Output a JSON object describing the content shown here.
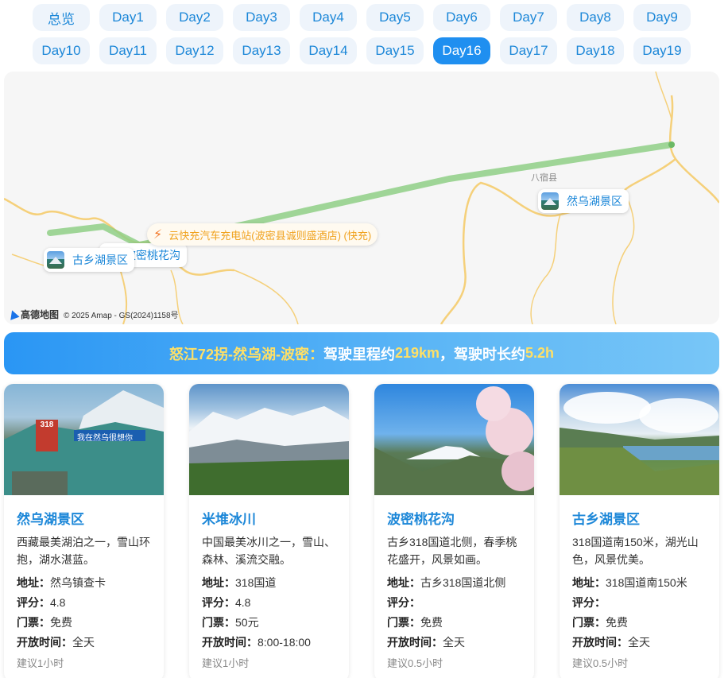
{
  "tabs": [
    "总览",
    "Day1",
    "Day2",
    "Day3",
    "Day4",
    "Day5",
    "Day6",
    "Day7",
    "Day8",
    "Day9",
    "Day10",
    "Day11",
    "Day12",
    "Day13",
    "Day14",
    "Day15",
    "Day16",
    "Day17",
    "Day18",
    "Day19"
  ],
  "active_tab": "Day16",
  "map": {
    "markers": {
      "ranwu": "然乌湖景区",
      "guxiang": "古乡湖景区",
      "taohua": "波密桃花沟"
    },
    "charger": "云快充汽车充电站(波密县诚则盛酒店) (快充)",
    "place_label": "八宿县",
    "copyright": "© 2025 Amap - GS(2024)1158号",
    "logo_text": "高德地图",
    "route_color": "#8fcf86",
    "road_color": "#f5d07a"
  },
  "banner": {
    "prefix": "怒江72拐-然乌湖-波密：",
    "distance_label": "驾驶里程约",
    "distance_value": "219km",
    "sep": "，",
    "duration_label": "驾驶时长约",
    "duration_value": "5.2h"
  },
  "labels": {
    "address": "地址：",
    "rating": "评分：",
    "ticket": "门票：",
    "hours": "开放时间："
  },
  "cards": [
    {
      "title": "然乌湖景区",
      "desc": "西藏最美湖泊之一，雪山环抱，湖水湛蓝。",
      "address": "然乌镇查卡",
      "rating": "4.8",
      "ticket": "免费",
      "hours": "全天",
      "tip": "建议1小时",
      "photo_sign": "我在然乌很想你",
      "photo_badge": "318"
    },
    {
      "title": "米堆冰川",
      "desc": "中国最美冰川之一，雪山、森林、溪流交融。",
      "address": "318国道",
      "rating": "4.8",
      "ticket": "50元",
      "hours": "8:00-18:00",
      "tip": "建议1小时"
    },
    {
      "title": "波密桃花沟",
      "desc": "古乡318国道北侧，春季桃花盛开，风景如画。",
      "address": "古乡318国道北侧",
      "rating": "",
      "ticket": "免费",
      "hours": "全天",
      "tip": "建议0.5小时"
    },
    {
      "title": "古乡湖景区",
      "desc": "318国道南150米，湖光山色，风景优美。",
      "address": "318国道南150米",
      "rating": "",
      "ticket": "免费",
      "hours": "全天",
      "tip": "建议0.5小时"
    }
  ]
}
